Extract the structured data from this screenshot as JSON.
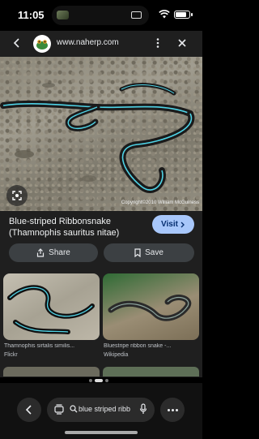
{
  "status_bar": {
    "time": "11:05",
    "battery_level": 0.8
  },
  "header": {
    "url": "www.naherp.com"
  },
  "hero": {
    "copyright": "Copyright©2010 William McGuiness"
  },
  "result": {
    "title": "Blue-striped Ribbonsnake (Thamnophis sauritus nitae)",
    "visit_label": "Visit",
    "share_label": "Share",
    "save_label": "Save"
  },
  "related": [
    {
      "caption": "Thamnophis sirtalis similis...",
      "source": "Flickr"
    },
    {
      "caption": "Bluestripe ribbon snake -...",
      "source": "Wikipedia"
    }
  ],
  "pager": {
    "count": 3,
    "active": 2
  },
  "toolbar": {
    "query": "blue striped ribbo"
  },
  "colors": {
    "accent": "#a8c7fa",
    "panel": "#1f1f1f",
    "button": "#3c4043",
    "snake_stripe": "#4fd3e6"
  }
}
